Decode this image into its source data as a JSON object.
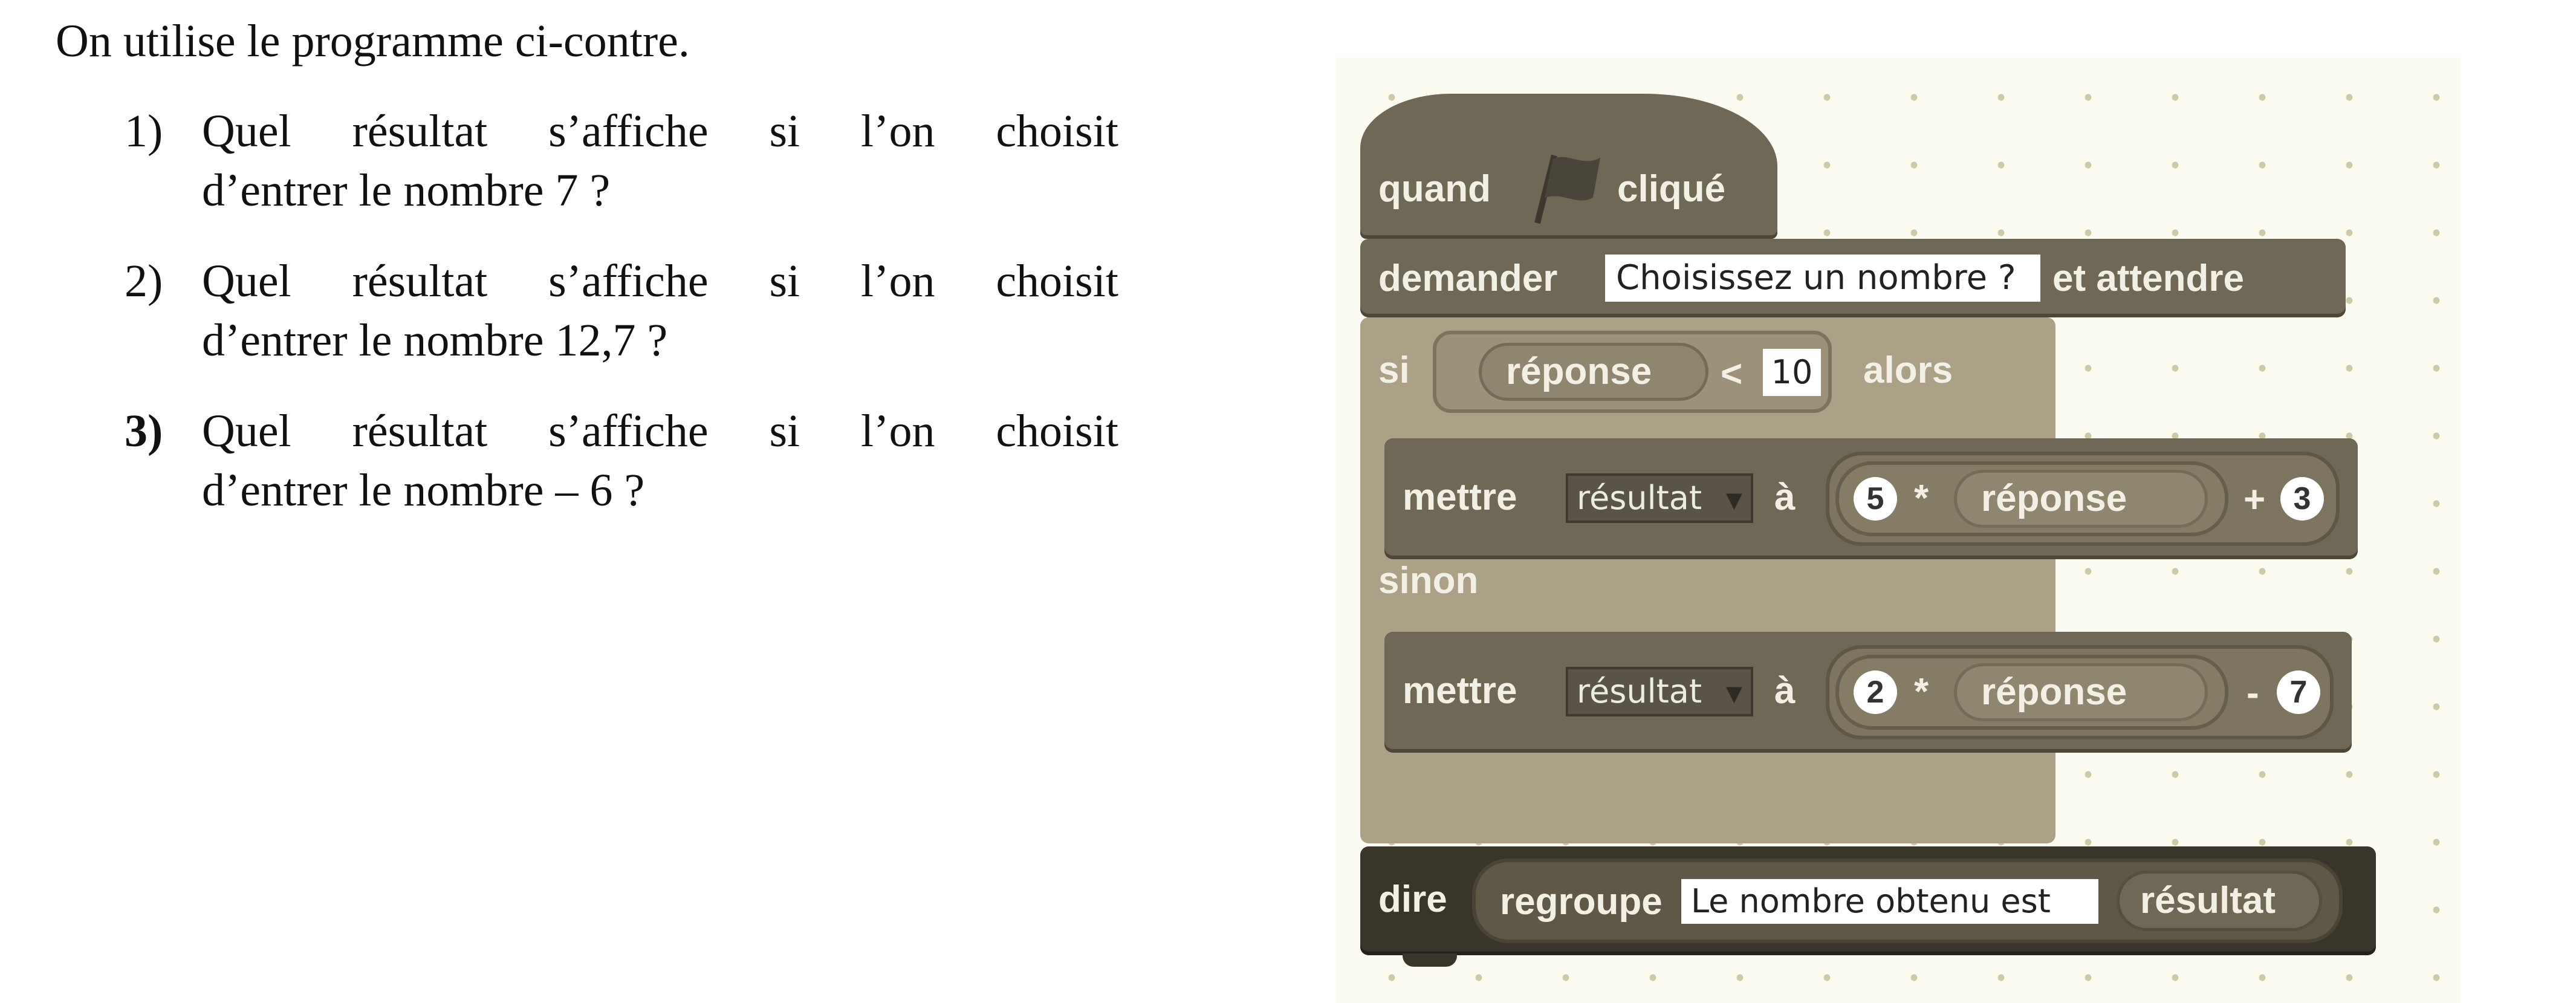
{
  "intro": "On utilise le programme ci-contre.",
  "questions": [
    {
      "num": "1)",
      "line1": [
        "Quel",
        "résultat",
        "s’affiche",
        "si",
        "l’on",
        "choisit"
      ],
      "line2": "d’entrer le nombre 7 ?"
    },
    {
      "num": "2)",
      "line1": [
        "Quel",
        "résultat",
        "s’affiche",
        "si",
        "l’on",
        "choisit"
      ],
      "line2": "d’entrer le nombre 12,7 ?"
    },
    {
      "num": "3)",
      "line1": [
        "Quel",
        "résultat",
        "s’affiche",
        "si",
        "l’on",
        "choisit"
      ],
      "line2": "d’entrer le nombre – 6 ?"
    }
  ],
  "program": {
    "hat": {
      "when": "quand",
      "clicked": "cliqué",
      "icon": "green-flag-icon"
    },
    "ask": {
      "label": "demander",
      "prompt": "Choisissez un nombre ?",
      "wait": "et attendre"
    },
    "if": {
      "label": "si",
      "answer": "réponse",
      "op": "<",
      "value": "10",
      "then": "alors"
    },
    "set1": {
      "label": "mettre",
      "var": "résultat",
      "to": "à",
      "a": "5",
      "mul": "*",
      "answer": "réponse",
      "op": "+",
      "b": "3"
    },
    "else": "sinon",
    "set2": {
      "label": "mettre",
      "var": "résultat",
      "to": "à",
      "a": "2",
      "mul": "*",
      "answer": "réponse",
      "op": "-",
      "b": "7"
    },
    "say": {
      "label": "dire",
      "join": "regroupe",
      "text": "Le nombre obtenu est",
      "var": "résultat"
    }
  }
}
